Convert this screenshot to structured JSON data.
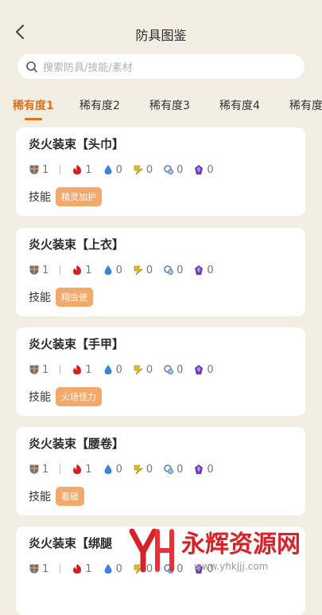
{
  "header": {
    "title": "防具图鉴",
    "back_icon": "chevron-left-icon"
  },
  "search": {
    "placeholder": "搜索防具/技能/素材",
    "icon": "search-icon"
  },
  "tabs": [
    {
      "label": "稀有度1",
      "active": true
    },
    {
      "label": "稀有度2",
      "active": false
    },
    {
      "label": "稀有度3",
      "active": false
    },
    {
      "label": "稀有度4",
      "active": false
    },
    {
      "label": "稀有度",
      "active": false
    }
  ],
  "skill_label": "技能",
  "stat_icons": [
    "shield-icon",
    "fire-icon",
    "water-drop-icon",
    "thunder-icon",
    "ice-icon",
    "dragon-icon"
  ],
  "armors": [
    {
      "name": "炎火装束【头巾】",
      "stats": [
        "1",
        "1",
        "0",
        "0",
        "0",
        "0"
      ],
      "skill": "精灵加护"
    },
    {
      "name": "炎火装束【上衣】",
      "stats": [
        "1",
        "1",
        "0",
        "0",
        "0",
        "0"
      ],
      "skill": "翔虫使"
    },
    {
      "name": "炎火装束【手甲】",
      "stats": [
        "1",
        "1",
        "0",
        "0",
        "0",
        "0"
      ],
      "skill": "火场怪力"
    },
    {
      "name": "炎火装束【腰卷】",
      "stats": [
        "1",
        "1",
        "0",
        "0",
        "0",
        "0"
      ],
      "skill": "看破"
    },
    {
      "name": "炎火装束【绑腿",
      "stats": [
        "1",
        "1",
        "0",
        "0",
        "0",
        "0"
      ],
      "skill": ""
    }
  ],
  "watermark": {
    "brand": "永辉资源网",
    "url": "www.yhkjjj.com"
  },
  "colors": {
    "accent": "#e0701e",
    "tag": "#f3a86c",
    "background": "#f3eee3"
  }
}
